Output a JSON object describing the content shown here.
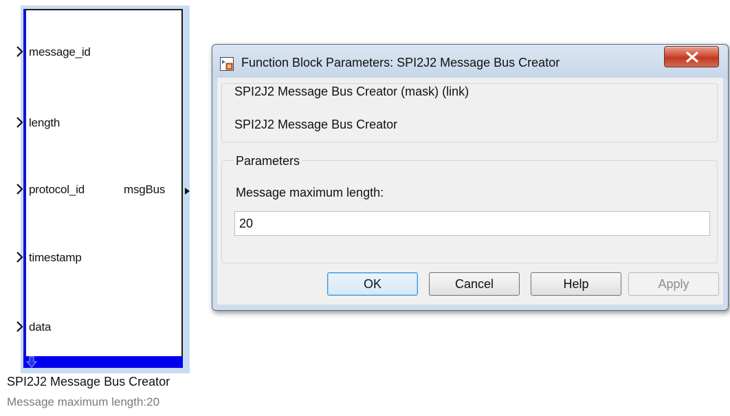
{
  "block": {
    "ports_in": [
      {
        "label": "message_id"
      },
      {
        "label": "length"
      },
      {
        "label": "protocol_id"
      },
      {
        "label": "timestamp"
      },
      {
        "label": "data"
      }
    ],
    "port_out": {
      "label": "msgBus"
    },
    "name": "SPI2J2 Message Bus Creator",
    "annotation": "Message maximum length:20",
    "colors": {
      "border": "#1010d8",
      "bottom_bar": "#0000ee",
      "highlight": "#c7dcf2"
    }
  },
  "dialog": {
    "title": "Function Block Parameters: SPI2J2 Message Bus Creator",
    "close_icon": "close-x-icon",
    "description_group_title": "SPI2J2 Message Bus Creator (mask) (link)",
    "description_text": "SPI2J2 Message Bus Creator",
    "parameters_group_title": "Parameters",
    "param_label": "Message maximum length:",
    "param_value": "20",
    "buttons": {
      "ok": "OK",
      "cancel": "Cancel",
      "help": "Help",
      "apply": "Apply"
    },
    "colors": {
      "close_button": "#c9452c",
      "ok_focus": "#3b93d6",
      "apply_disabled": "#8d8d8d"
    }
  }
}
